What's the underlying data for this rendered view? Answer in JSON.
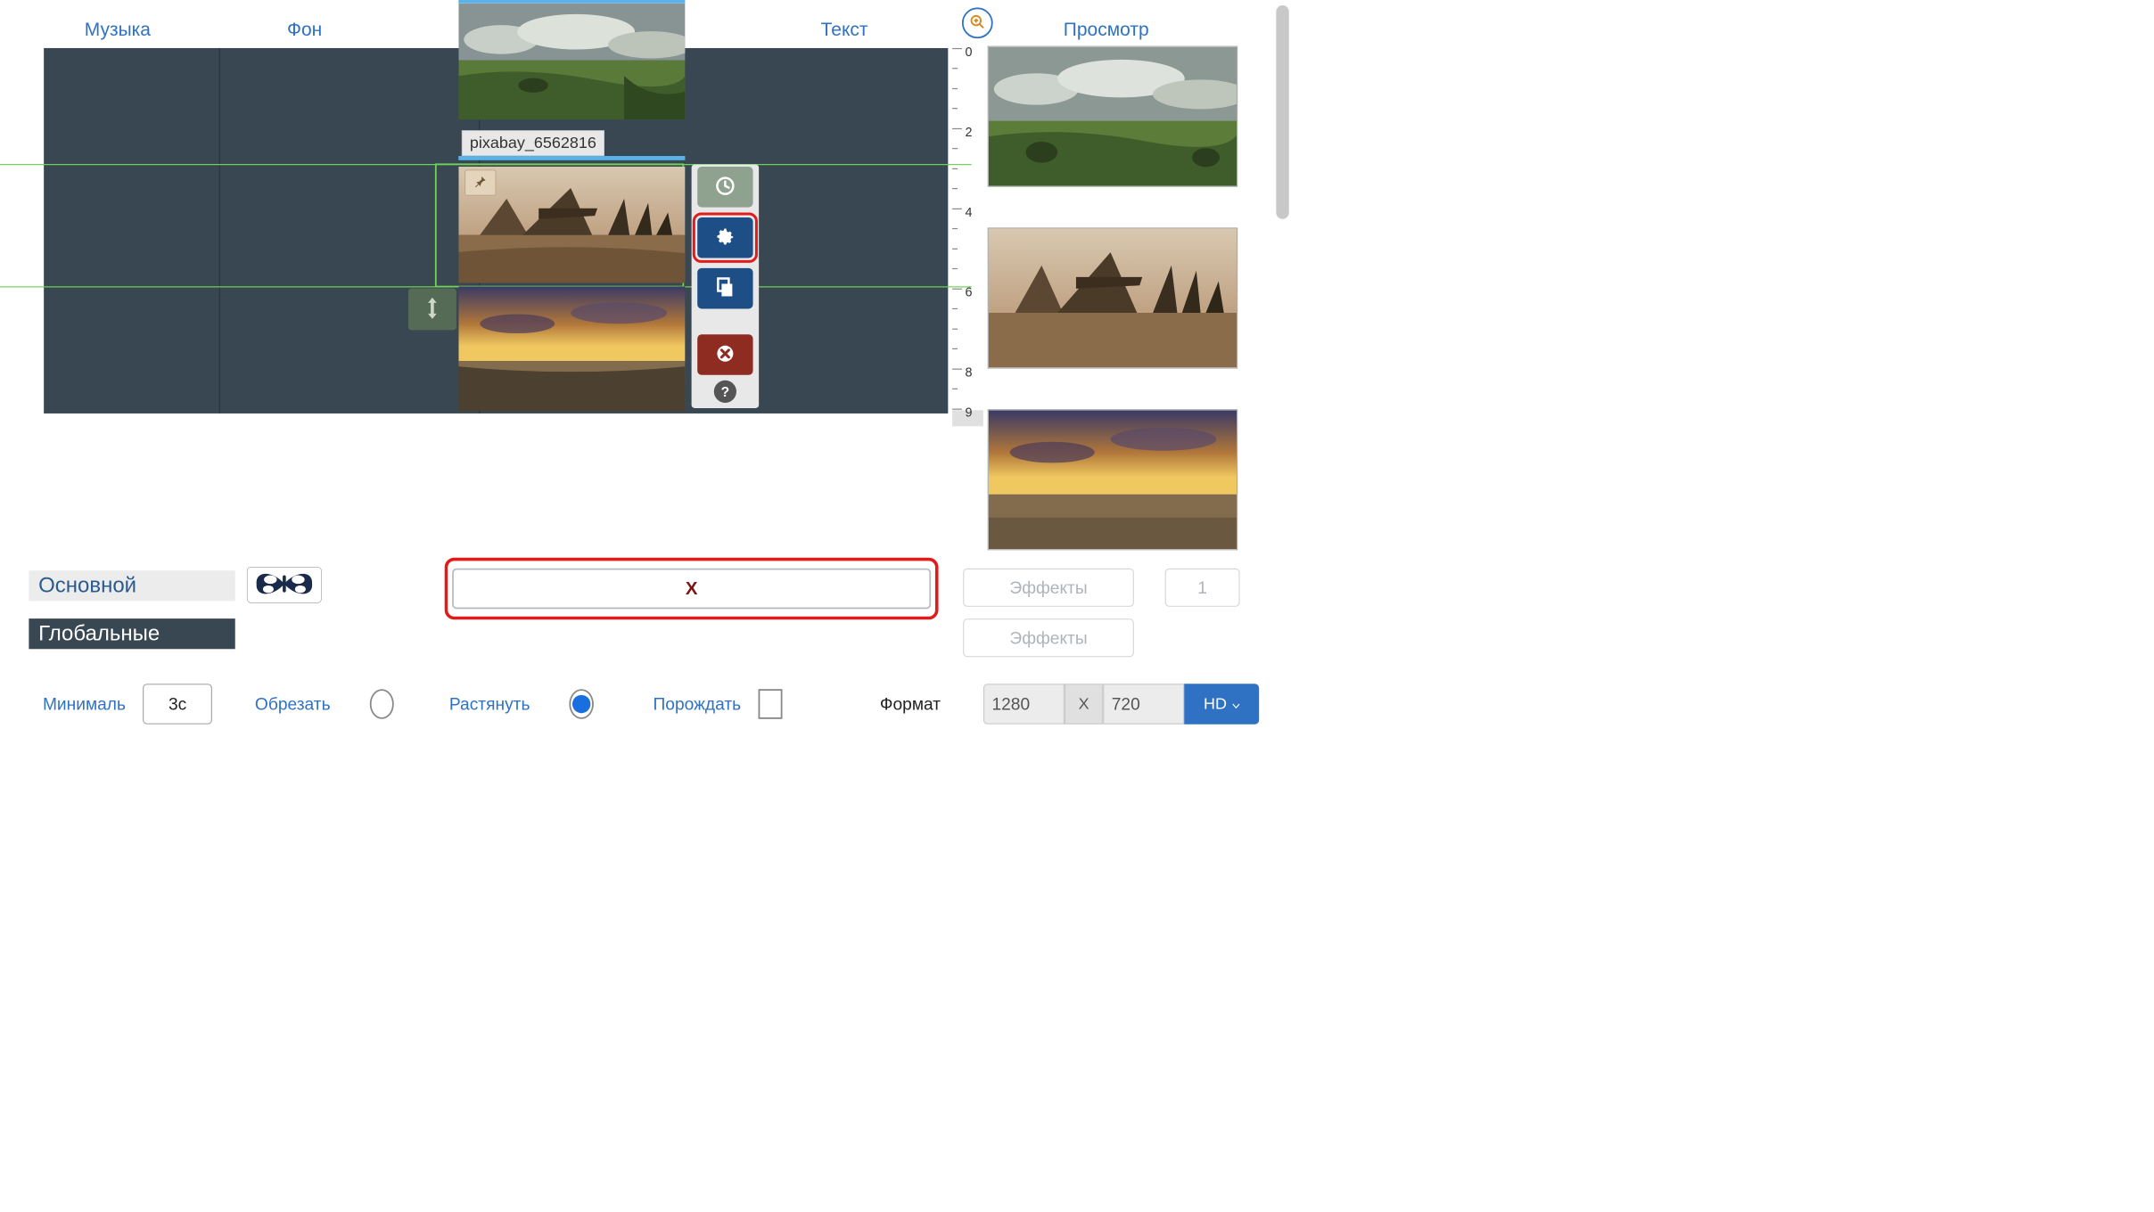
{
  "tabs": {
    "music": "Музыка",
    "background": "Фон",
    "main": "Основной",
    "text": "Текст",
    "preview": "Просмотр"
  },
  "timeline": {
    "clip1_label": "pixabay_6562816",
    "ruler": [
      "0",
      "2",
      "4",
      "6",
      "8",
      "9"
    ]
  },
  "bottom_tabs": {
    "main": "Основной",
    "global": "Глобальные"
  },
  "close_btn": "X",
  "effects": {
    "label": "Эффекты",
    "count": "1"
  },
  "controls": {
    "minimal": "Минималь",
    "minimal_value": "3с",
    "crop": "Обрезать",
    "stretch": "Растянуть",
    "generate": "Порождать",
    "format_label": "Формат",
    "format_w": "1280",
    "format_x": "X",
    "format_h": "720",
    "hd": "HD"
  }
}
